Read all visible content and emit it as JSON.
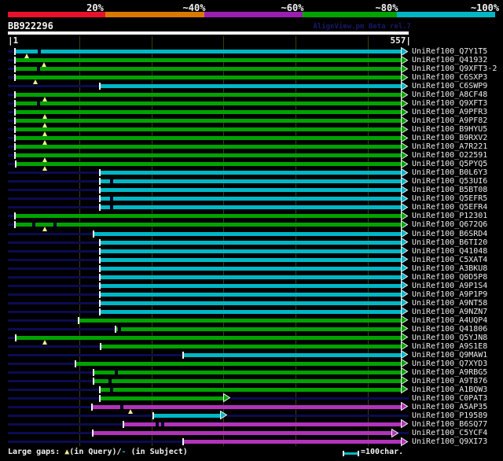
{
  "header": {
    "title": "BB922296",
    "watermark": "AlignView.pm Beta rel.7"
  },
  "colors": {
    "red": "#e8112d",
    "orange": "#d97900",
    "purple": "#9a1fb0",
    "green": "#00a300",
    "cyan": "#00b7c6",
    "magenta": "#b233bb",
    "navy": "#0b0b52",
    "grid": "#3e3e0a",
    "gap_marker": "#f2ee8d",
    "gap_dash": "#000028",
    "text": "#f0f0f0"
  },
  "scale": {
    "labels": [
      "20%",
      "~40%",
      "~60%",
      "~80%",
      "~100%"
    ],
    "colors": [
      "red",
      "orange",
      "purple",
      "green",
      "cyan"
    ]
  },
  "ruler": {
    "start_label": "|1",
    "end_label": "557|",
    "min": 1,
    "max": 557,
    "gridline_every": 100
  },
  "legend": {
    "prefix": "Large gaps: ",
    "query_symbol": "▲",
    "mid": "(in Query)/",
    "subject_symbol": "-",
    "suffix": " (in Subject)",
    "scale_text": "=100char."
  },
  "chart_data": {
    "type": "alignment",
    "title": "BB922296",
    "query_range": [
      1,
      557
    ],
    "identity_buckets": [
      "20%",
      "~40%",
      "~60%",
      "~80%",
      "~100%"
    ],
    "rows": [
      {
        "id": "UniRef100_Q7Y1T5",
        "color": "cyan",
        "start": 12,
        "end": 546,
        "dashes": [
          45
        ],
        "tris": [
          27
        ]
      },
      {
        "id": "UniRef100_Q41932",
        "color": "green",
        "start": 12,
        "end": 546,
        "tris": [
          51
        ]
      },
      {
        "id": "UniRef100_Q9XFT3-2",
        "color": "green",
        "start": 12,
        "end": 546,
        "dashes": [
          44
        ]
      },
      {
        "id": "UniRef100_C6SXP3",
        "color": "green",
        "start": 12,
        "end": 546,
        "tris": [
          39
        ]
      },
      {
        "id": "UniRef100_C6SWP9",
        "color": "cyan",
        "start": 130,
        "end": 546
      },
      {
        "id": "UniRef100_A8CF48",
        "color": "green",
        "start": 12,
        "end": 546,
        "tris": [
          52
        ]
      },
      {
        "id": "UniRef100_Q9XFT3",
        "color": "green",
        "start": 12,
        "end": 546,
        "dashes": [
          44
        ]
      },
      {
        "id": "UniRef100_A9PFR3",
        "color": "green",
        "start": 12,
        "end": 546,
        "tris": [
          52
        ]
      },
      {
        "id": "UniRef100_A9PF82",
        "color": "green",
        "start": 12,
        "end": 546,
        "tris": [
          52
        ]
      },
      {
        "id": "UniRef100_B9HYU5",
        "color": "green",
        "start": 12,
        "end": 546,
        "tris": [
          52
        ]
      },
      {
        "id": "UniRef100_B9RXV2",
        "color": "green",
        "start": 12,
        "end": 546,
        "tris": [
          52
        ]
      },
      {
        "id": "UniRef100_A7R221",
        "color": "green",
        "start": 12,
        "end": 546
      },
      {
        "id": "UniRef100_O22591",
        "color": "green",
        "start": 12,
        "end": 546,
        "tris": [
          52
        ]
      },
      {
        "id": "UniRef100_Q5PYQ5",
        "color": "green",
        "start": 13,
        "end": 546,
        "tris": [
          52
        ]
      },
      {
        "id": "UniRef100_B0L6Y3",
        "color": "cyan",
        "start": 130,
        "end": 546
      },
      {
        "id": "UniRef100_Q53UI6",
        "color": "cyan",
        "start": 130,
        "end": 546,
        "dashes": [
          145
        ]
      },
      {
        "id": "UniRef100_B5BT08",
        "color": "cyan",
        "start": 130,
        "end": 546
      },
      {
        "id": "UniRef100_Q5EFR5",
        "color": "cyan",
        "start": 130,
        "end": 546,
        "dashes": [
          145
        ]
      },
      {
        "id": "UniRef100_Q5EFR4",
        "color": "cyan",
        "start": 130,
        "end": 546,
        "dashes": [
          145
        ]
      },
      {
        "id": "UniRef100_P12301",
        "color": "green",
        "start": 12,
        "end": 546
      },
      {
        "id": "UniRef100_Q672Q6",
        "color": "green",
        "start": 12,
        "end": 546,
        "dashes": [
          37,
          66
        ],
        "tris": [
          52
        ]
      },
      {
        "id": "UniRef100_B6SRD4",
        "color": "cyan",
        "start": 121,
        "end": 546
      },
      {
        "id": "UniRef100_B6TI20",
        "color": "cyan",
        "start": 130,
        "end": 546
      },
      {
        "id": "UniRef100_Q41048",
        "color": "cyan",
        "start": 130,
        "end": 546
      },
      {
        "id": "UniRef100_C5XAT4",
        "color": "cyan",
        "start": 130,
        "end": 546
      },
      {
        "id": "UniRef100_A3BKU8",
        "color": "cyan",
        "start": 130,
        "end": 546
      },
      {
        "id": "UniRef100_Q0D5P8",
        "color": "cyan",
        "start": 130,
        "end": 546
      },
      {
        "id": "UniRef100_A9P1S4",
        "color": "cyan",
        "start": 130,
        "end": 546
      },
      {
        "id": "UniRef100_A9P1P9",
        "color": "cyan",
        "start": 130,
        "end": 546
      },
      {
        "id": "UniRef100_A9NT58",
        "color": "cyan",
        "start": 130,
        "end": 546
      },
      {
        "id": "UniRef100_A9NZN7",
        "color": "cyan",
        "start": 130,
        "end": 546
      },
      {
        "id": "UniRef100_A4UQP4",
        "color": "green",
        "start": 100,
        "end": 546
      },
      {
        "id": "UniRef100_Q41806",
        "color": "green",
        "start": 151,
        "end": 546,
        "dashes": [
          156
        ]
      },
      {
        "id": "UniRef100_Q5YJN8",
        "color": "green",
        "start": 13,
        "end": 546,
        "tris": [
          52
        ]
      },
      {
        "id": "UniRef100_A9S1E8",
        "color": "green",
        "start": 131,
        "end": 546
      },
      {
        "id": "UniRef100_Q9MAW1",
        "color": "cyan",
        "start": 245,
        "end": 546
      },
      {
        "id": "UniRef100_Q7XYD3",
        "color": "green",
        "start": 96,
        "end": 546
      },
      {
        "id": "UniRef100_A9RBG5",
        "color": "green",
        "start": 121,
        "end": 546,
        "dashes": [
          151
        ]
      },
      {
        "id": "UniRef100_A9T876",
        "color": "green",
        "start": 121,
        "end": 546,
        "dashes": [
          143
        ]
      },
      {
        "id": "UniRef100_A1BQW3",
        "color": "green",
        "start": 130,
        "end": 546,
        "dashes": [
          145
        ]
      },
      {
        "id": "UniRef100_C0PAT3",
        "color": "green",
        "start": 130,
        "end": 300,
        "tail": true
      },
      {
        "id": "UniRef100_A5AP35",
        "color": "magenta",
        "start": 119,
        "end": 546,
        "dashes": [
          159
        ],
        "tris": [
          171
        ]
      },
      {
        "id": "UniRef100_P19589",
        "color": "cyan",
        "start": 204,
        "end": 295,
        "tail": true
      },
      {
        "id": "UniRef100_B6SQ77",
        "color": "magenta",
        "start": 162,
        "end": 546,
        "dashes": [
          208,
          216
        ]
      },
      {
        "id": "UniRef100_C5YCF4",
        "color": "magenta",
        "start": 120,
        "end": 533,
        "tail": true
      },
      {
        "id": "UniRef100_Q9XI73",
        "color": "magenta",
        "start": 245,
        "end": 546
      }
    ]
  }
}
